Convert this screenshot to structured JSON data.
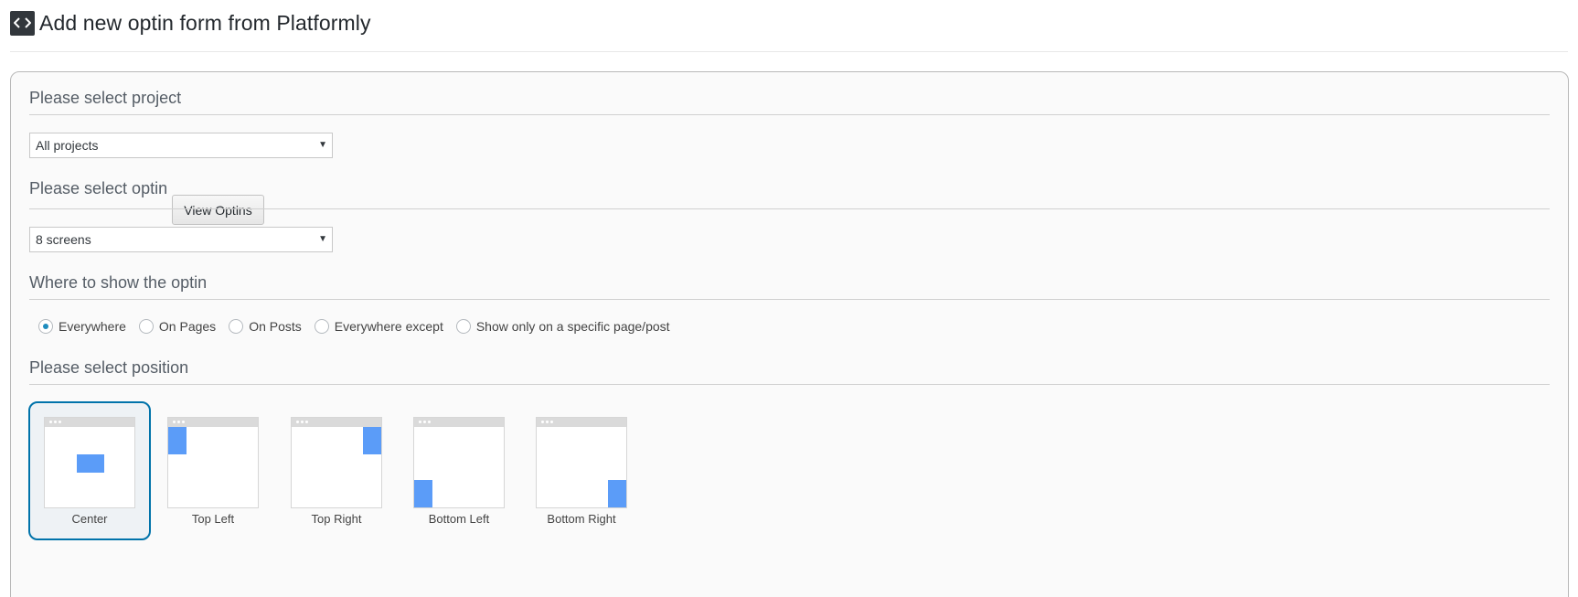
{
  "header": {
    "icon": "code-icon",
    "title": "Add new optin form from Platformly"
  },
  "project_section": {
    "heading": "Please select project",
    "selected": "All projects"
  },
  "optin_section": {
    "heading": "Please select optin",
    "view_button": "View Optins",
    "selected": "8 screens"
  },
  "where_section": {
    "heading": "Where to show the optin",
    "options": [
      {
        "label": "Everywhere",
        "checked": true
      },
      {
        "label": "On Pages",
        "checked": false
      },
      {
        "label": "On Posts",
        "checked": false
      },
      {
        "label": "Everywhere except",
        "checked": false
      },
      {
        "label": "Show only on a specific page/post",
        "checked": false
      }
    ]
  },
  "position_section": {
    "heading": "Please select position",
    "options": [
      {
        "label": "Center",
        "selected": true
      },
      {
        "label": "Top Left",
        "selected": false
      },
      {
        "label": "Top Right",
        "selected": false
      },
      {
        "label": "Bottom Left",
        "selected": false
      },
      {
        "label": "Bottom Right",
        "selected": false
      }
    ]
  },
  "colors": {
    "accent": "#0073aa",
    "radio_checked": "#1e8cbe",
    "position_block": "#5b9cf8"
  }
}
